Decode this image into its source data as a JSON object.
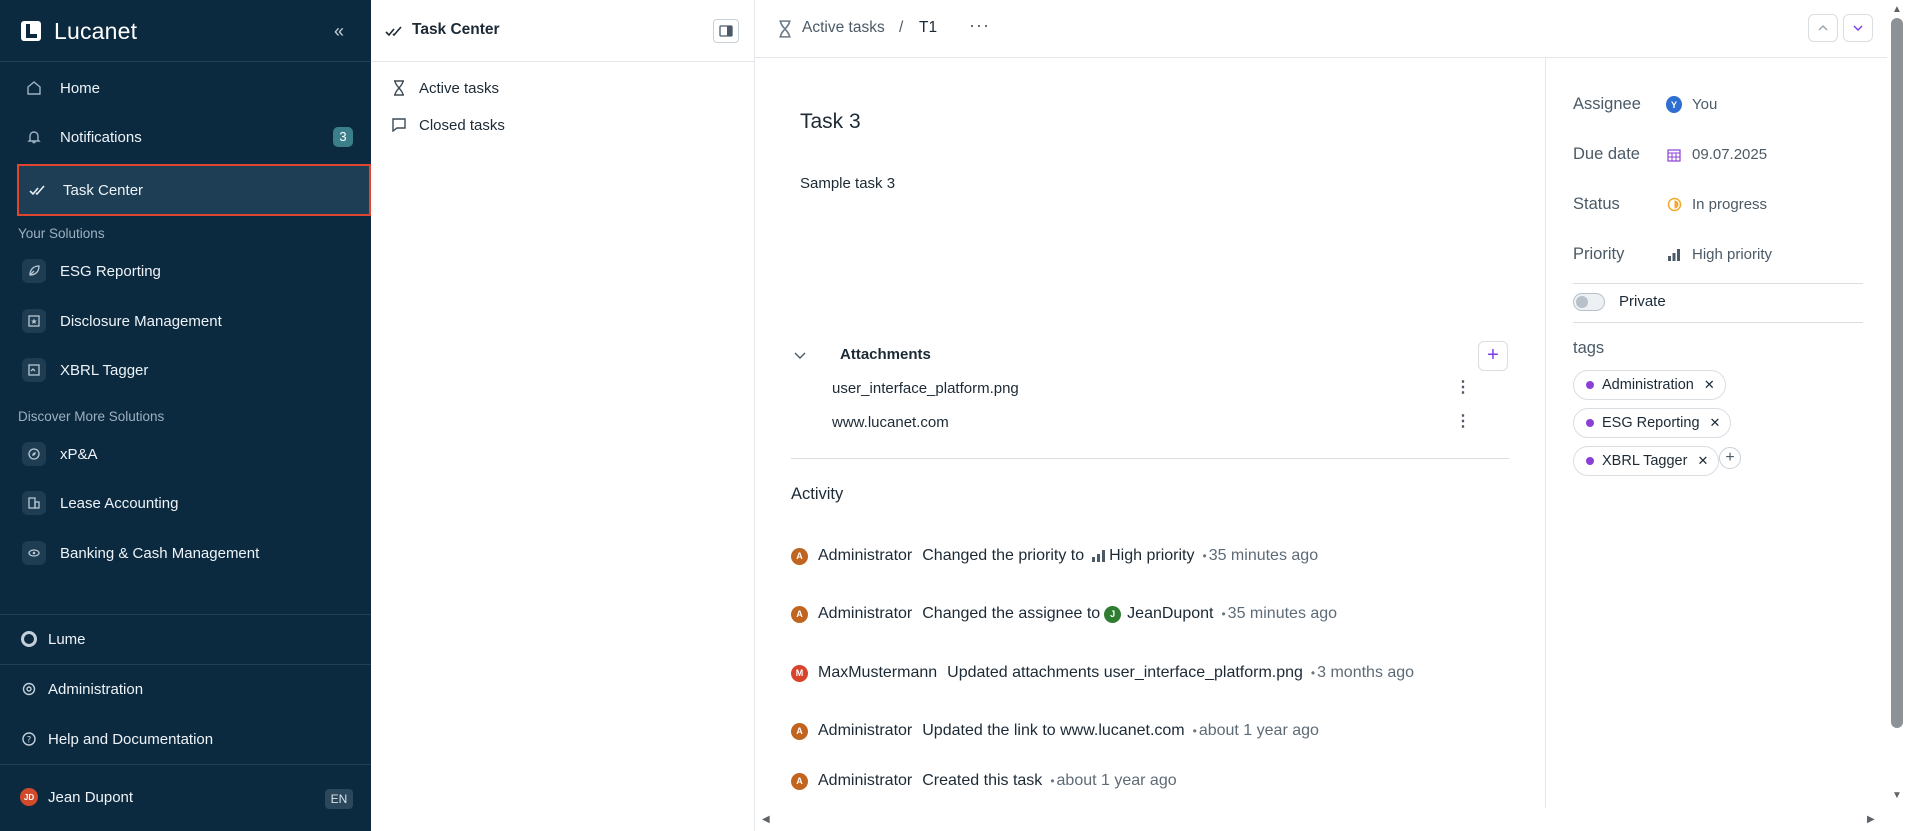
{
  "sidebar": {
    "logo_text": "Lucanet",
    "nav": [
      {
        "label": "Home",
        "icon": "home-icon"
      },
      {
        "label": "Notifications",
        "icon": "bell-icon",
        "badge": "3"
      },
      {
        "label": "Task Center",
        "icon": "check-double-icon",
        "active": true
      }
    ],
    "your_solutions_label": "Your Solutions",
    "your_solutions": [
      {
        "label": "ESG Reporting",
        "icon": "leaf-icon"
      },
      {
        "label": "Disclosure Management",
        "icon": "document-star-icon"
      },
      {
        "label": "XBRL Tagger",
        "icon": "tag-document-icon"
      }
    ],
    "discover_label": "Discover More Solutions",
    "discover": [
      {
        "label": "xP&A",
        "icon": "compass-icon"
      },
      {
        "label": "Lease Accounting",
        "icon": "buildings-icon"
      },
      {
        "label": "Banking & Cash Management",
        "icon": "coins-icon"
      }
    ],
    "lume": "Lume",
    "administration": "Administration",
    "help": "Help and Documentation",
    "user_name": "Jean Dupont",
    "user_initials": "JD",
    "language": "EN"
  },
  "middle": {
    "title": "Task Center",
    "items": [
      {
        "label": "Active tasks",
        "icon": "hourglass-icon"
      },
      {
        "label": "Closed tasks",
        "icon": "closed-task-icon"
      }
    ]
  },
  "breadcrumb": {
    "parent": "Active tasks",
    "separator": "/",
    "current": "T1",
    "more": "···"
  },
  "task": {
    "title": "Task 3",
    "description": "Sample task 3"
  },
  "attachments": {
    "title": "Attachments",
    "files": [
      "user_interface_platform.png",
      "www.lucanet.com"
    ]
  },
  "activity": {
    "title": "Activity",
    "entries": [
      {
        "initial": "A",
        "user": "Administrator",
        "text": "Changed the priority to",
        "extra": "High priority",
        "time": "35 minutes ago"
      },
      {
        "initial": "A",
        "user": "Administrator",
        "text": "Changed the assignee to",
        "extra_initial": "J",
        "extra": "JeanDupont",
        "time": "35 minutes ago"
      },
      {
        "initial": "M",
        "user": "MaxMustermann",
        "text": "Updated attachments user_interface_platform.png",
        "time": "3 months ago"
      },
      {
        "initial": "A",
        "user": "Administrator",
        "text": "Updated the link to www.lucanet.com",
        "time": "about 1 year ago"
      },
      {
        "initial": "A",
        "user": "Administrator",
        "text": "Created this task",
        "time": "about 1 year ago"
      }
    ]
  },
  "details": {
    "assignee_label": "Assignee",
    "assignee_initial": "Y",
    "assignee_value": "You",
    "due_label": "Due date",
    "due_value": "09.07.2025",
    "status_label": "Status",
    "status_value": "In progress",
    "priority_label": "Priority",
    "priority_value": "High priority",
    "private_label": "Private",
    "private_on": false,
    "tags_label": "tags",
    "tags": [
      "Administration",
      "ESG Reporting",
      "XBRL Tagger"
    ]
  },
  "colors": {
    "sidebar_bg": "#0b2a40",
    "accent": "#7c3aed",
    "active_border": "#e0462f",
    "tag_dot": "#8b3fd9"
  }
}
